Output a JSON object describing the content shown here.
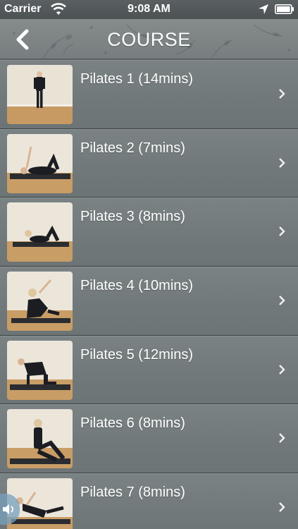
{
  "status_bar": {
    "carrier": "Carrier",
    "time": "9:08 AM",
    "icons": [
      "wifi-icon",
      "location-arrow-icon",
      "battery-icon"
    ]
  },
  "nav": {
    "back_icon": "chevron-left-icon",
    "title": "COURSE"
  },
  "courses": [
    {
      "label": "Pilates 1 (14mins)",
      "thumb": "standing-pose"
    },
    {
      "label": "Pilates 2 (7mins)",
      "thumb": "lying-arm-raise-pose"
    },
    {
      "label": "Pilates 3 (8mins)",
      "thumb": "knees-bent-lying-pose"
    },
    {
      "label": "Pilates 4 (10mins)",
      "thumb": "side-reach-pose"
    },
    {
      "label": "Pilates 5 (12mins)",
      "thumb": "all-fours-pose"
    },
    {
      "label": "Pilates 6 (8mins)",
      "thumb": "seated-stretch-pose"
    },
    {
      "label": "Pilates 7 (8mins)",
      "thumb": "lying-leg-raise-pose"
    }
  ],
  "row_chevron_icon": "chevron-right-icon",
  "sound_icon": "speaker-icon",
  "colors": {
    "background": "#6f7779",
    "row_divider": "#3e4446",
    "text": "#ffffff"
  }
}
